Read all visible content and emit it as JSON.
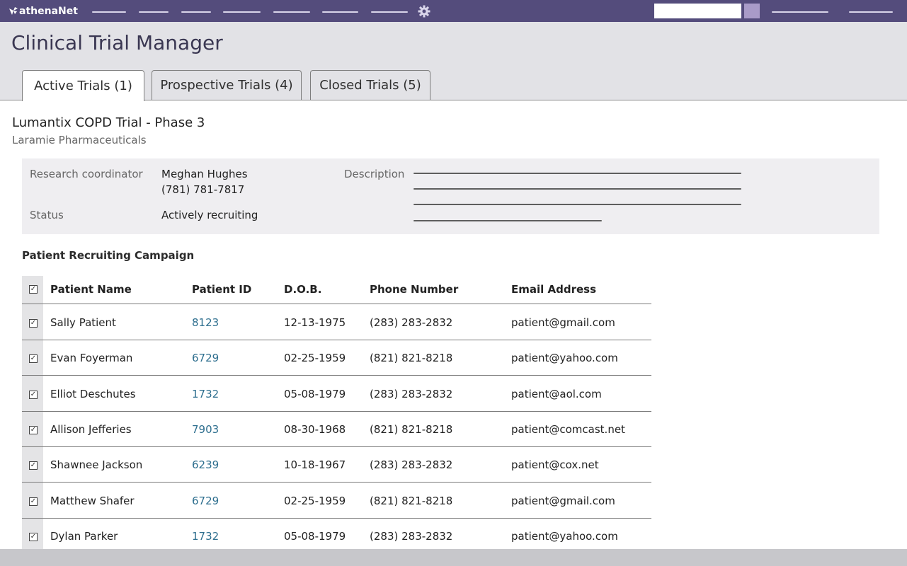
{
  "app": {
    "brand": "athenaNet"
  },
  "page": {
    "title": "Clinical Trial Manager"
  },
  "tabs": [
    {
      "label": "Active Trials (1)",
      "active": true
    },
    {
      "label": "Prospective Trials (4)",
      "active": false
    },
    {
      "label": "Closed Trials (5)",
      "active": false
    }
  ],
  "trial": {
    "title": "Lumantix COPD Trial - Phase 3",
    "sponsor": "Laramie Pharmaceuticals",
    "coordinator_label": "Research coordinator",
    "coordinator_name": "Meghan Hughes",
    "coordinator_phone": "(781) 781-7817",
    "status_label": "Status",
    "status_value": "Actively recruiting",
    "description_label": "Description"
  },
  "campaign": {
    "title": "Patient Recruiting Campaign",
    "columns": [
      "Patient Name",
      "Patient ID",
      "D.O.B.",
      "Phone Number",
      "Email Address"
    ],
    "rows": [
      {
        "name": "Sally Patient",
        "id": "8123",
        "dob": "12-13-1975",
        "phone": "(283) 283-2832",
        "email": "patient@gmail.com"
      },
      {
        "name": "Evan Foyerman",
        "id": "6729",
        "dob": "02-25-1959",
        "phone": "(821) 821-8218",
        "email": "patient@yahoo.com"
      },
      {
        "name": "Elliot Deschutes",
        "id": "1732",
        "dob": "05-08-1979",
        "phone": "(283) 283-2832",
        "email": "patient@aol.com"
      },
      {
        "name": "Allison Jefferies",
        "id": "7903",
        "dob": "08-30-1968",
        "phone": "(821) 821-8218",
        "email": "patient@comcast.net"
      },
      {
        "name": "Shawnee Jackson",
        "id": "6239",
        "dob": "10-18-1967",
        "phone": "(283) 283-2832",
        "email": "patient@cox.net"
      },
      {
        "name": "Matthew Shafer",
        "id": "6729",
        "dob": "02-25-1959",
        "phone": "(821) 821-8218",
        "email": "patient@gmail.com"
      },
      {
        "name": "Dylan Parker",
        "id": "1732",
        "dob": "05-08-1979",
        "phone": "(283) 283-2832",
        "email": "patient@yahoo.com"
      }
    ]
  },
  "icons": {
    "gear": "gear-icon",
    "logo": "leaf-logo-icon",
    "checkbox": "checkbox-checked-icon"
  },
  "colors": {
    "nav": "#544c7c",
    "accent": "#a99bc8",
    "link": "#2d6e8e"
  }
}
